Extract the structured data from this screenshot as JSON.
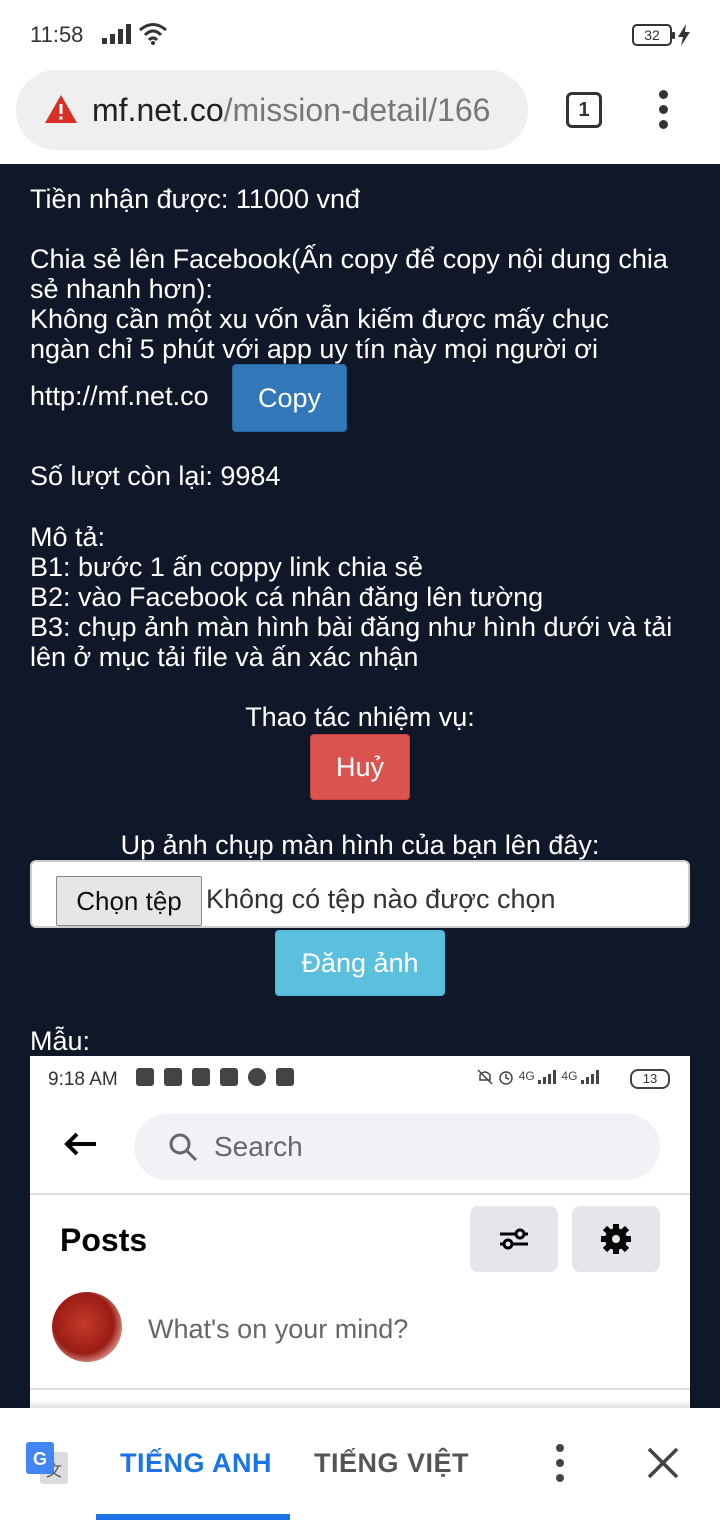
{
  "status_bar": {
    "time": "11:58",
    "battery": "32"
  },
  "browser": {
    "url_host": "mf.net.co",
    "url_path": "/mission-detail/166",
    "tab_count": "1"
  },
  "mission": {
    "reward": "Tiền nhận được: 11000 vnđ",
    "share_heading_line1": "Chia sẻ lên Facebook(Ấn copy để copy nội dung chia",
    "share_heading_line2": "sẻ nhanh hơn):",
    "share_text_line1": "Không cần một xu vốn vẫn kiếm được mấy chục",
    "share_text_line2": "ngàn chỉ 5 phút với app uy tín này mọi người ơi",
    "share_link": "http://mf.net.co",
    "copy_label": "Copy",
    "remaining": "Số lượt còn lại: 9984",
    "desc_title": "Mô tả:",
    "step1": "B1: bước 1 ấn coppy link chia sẻ",
    "step2": "B2: vào Facebook cá nhân đăng lên tường",
    "step3_line1": "B3: chụp ảnh màn hình bài đăng như hình dưới và tải",
    "step3_line2": "lên ở mục tải file và ấn xác nhận",
    "actions_label": "Thao tác nhiệm vụ:",
    "cancel_label": "Huỷ",
    "upload_prompt": "Up ảnh chụp màn hình của bạn lên đây:",
    "choose_file_label": "Chọn tệp",
    "no_file_text": "Không có tệp nào được chọn",
    "post_image_label": "Đăng ảnh",
    "sample_label": "Mẫu:"
  },
  "sample_screenshot": {
    "time": "9:18 AM",
    "battery": "13",
    "network": "4G",
    "search_placeholder": "Search",
    "posts_title": "Posts",
    "composer_placeholder": "What's on your mind?"
  },
  "translate_bar": {
    "tab_source": "TIẾNG ANH",
    "tab_target": "TIẾNG VIỆT",
    "accent_color": "#1a73e8"
  },
  "colors": {
    "page_background": "#0f1728",
    "copy_button": "#3278b8",
    "cancel_button": "#d9534f",
    "upload_button": "#5bc0de"
  }
}
